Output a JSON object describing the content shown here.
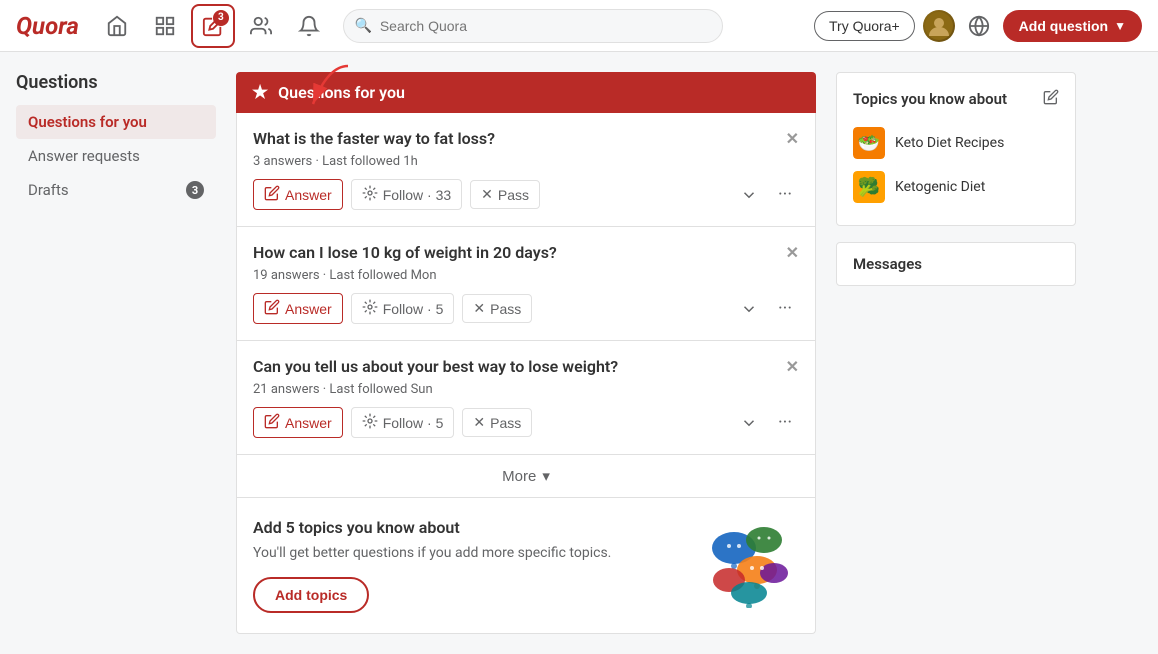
{
  "app": {
    "name": "Quora",
    "logo": "Quora"
  },
  "header": {
    "search_placeholder": "Search Quora",
    "try_quora_label": "Try Quora+",
    "add_question_label": "Add question",
    "nav_badge": "3"
  },
  "sidebar": {
    "section_title": "Questions",
    "items": [
      {
        "id": "questions-for-you",
        "label": "Questions for you",
        "active": true,
        "badge": null
      },
      {
        "id": "answer-requests",
        "label": "Answer requests",
        "active": false,
        "badge": null
      },
      {
        "id": "drafts",
        "label": "Drafts",
        "active": false,
        "badge": "3"
      }
    ]
  },
  "main": {
    "section_title": "Questions for you",
    "questions": [
      {
        "id": 1,
        "title": "What is the faster way to fat loss?",
        "meta": "3 answers · Last followed 1h",
        "actions": {
          "answer": "Answer",
          "follow": "Follow",
          "follow_count": "33",
          "pass": "Pass"
        }
      },
      {
        "id": 2,
        "title": "How can I lose 10 kg of weight in 20 days?",
        "meta": "19 answers · Last followed Mon",
        "actions": {
          "answer": "Answer",
          "follow": "Follow",
          "follow_count": "5",
          "pass": "Pass"
        }
      },
      {
        "id": 3,
        "title": "Can you tell us about your best way to lose weight?",
        "meta": "21 answers · Last followed Sun",
        "actions": {
          "answer": "Answer",
          "follow": "Follow",
          "follow_count": "5",
          "pass": "Pass"
        }
      }
    ],
    "more_label": "More",
    "add_topics": {
      "title": "Add 5 topics you know about",
      "description": "You'll get better questions if you add more specific topics.",
      "button_label": "Add topics"
    }
  },
  "right_panel": {
    "topics_title": "Topics you know about",
    "topics": [
      {
        "id": "keto-diet",
        "name": "Keto Diet Recipes"
      },
      {
        "id": "ketogenic",
        "name": "Ketogenic Diet"
      }
    ],
    "messages_title": "Messages"
  },
  "colors": {
    "primary": "#b92b27",
    "text_main": "#333",
    "text_secondary": "#636466",
    "border": "#e0e0e0",
    "bg": "#f6f7f8"
  }
}
